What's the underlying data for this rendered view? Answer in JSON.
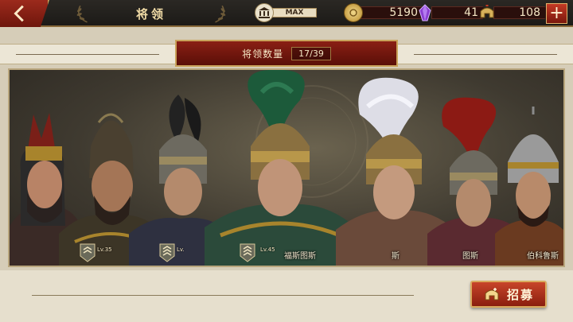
{
  "header": {
    "title": "将领",
    "max_label": "MAX",
    "resources": [
      {
        "name": "coin",
        "value": "5190"
      },
      {
        "name": "gem",
        "value": "41"
      },
      {
        "name": "helmet-token",
        "value": "108"
      }
    ]
  },
  "general_count": {
    "label": "将领数量",
    "value": "17/39"
  },
  "heroes": [
    {
      "level": "",
      "name": "",
      "plume": "#7a1f18"
    },
    {
      "level": "Lv.35",
      "name": "",
      "plume": "#4a4030"
    },
    {
      "level": "Lv.",
      "name": "",
      "plume": "#222222"
    },
    {
      "level": "Lv.45",
      "name": "福斯图斯",
      "plume": "#1c5a3a"
    },
    {
      "level": "",
      "name": "斯",
      "plume": "#dddde6"
    },
    {
      "level": "",
      "name": "图斯",
      "plume": "#8c1a14"
    },
    {
      "level": "",
      "name": "伯科鲁斯",
      "plume": "#8a8a8a"
    }
  ],
  "actions": {
    "recruit_label": "招募"
  },
  "colors": {
    "accent_red": "#9c2a1c",
    "gold": "#c9a25a",
    "parchment": "#e6dfcd"
  }
}
